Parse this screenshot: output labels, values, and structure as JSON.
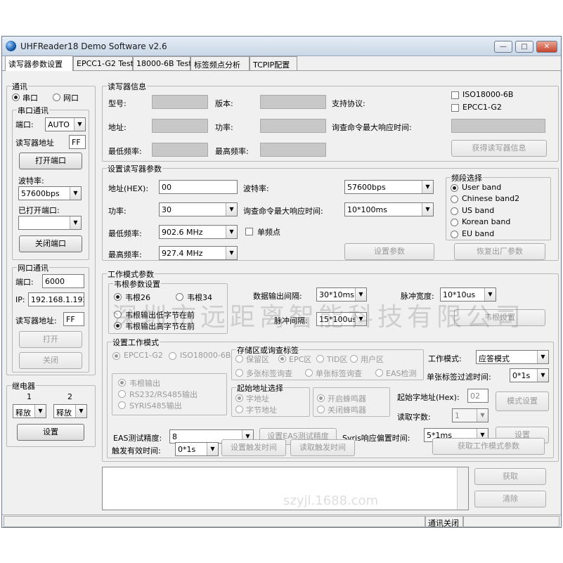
{
  "window": {
    "title": "UHFReader18 Demo Software v2.6",
    "controls": {
      "minimize": "—",
      "maximize": "□",
      "close": "✕"
    }
  },
  "tabs": [
    "读写器参数设置",
    "EPCC1-G2 Test",
    "18000-6B Test",
    "标签频点分析",
    "TCPIP配置"
  ],
  "comm": {
    "group_label": "通讯",
    "radio_serial": "串口",
    "radio_net": "网口",
    "serial_group": "串口通讯",
    "port_label": "端口:",
    "port_value": "AUTO",
    "addr_label": "读写器地址",
    "addr_value": "FF",
    "open_port_btn": "打开端口",
    "baud_label": "波特率:",
    "baud_value": "57600bps",
    "opened_label": "已打开端口:",
    "opened_value": "",
    "close_port_btn": "关闭端口",
    "net_group": "网口通讯",
    "net_port_label": "端口:",
    "net_port_value": "6000",
    "ip_label": "IP:",
    "ip_value": "192.168.1.192",
    "net_addr_label": "读写器地址:",
    "net_addr_value": "FF",
    "net_open_btn": "打开",
    "net_close_btn": "关闭"
  },
  "relay": {
    "group_label": "继电器",
    "col1": "1",
    "col2": "2",
    "sel1": "释放",
    "sel2": "释放",
    "set_btn": "设置"
  },
  "reader_info": {
    "group_label": "读写器信息",
    "model_label": "型号:",
    "version_label": "版本:",
    "protocol_label": "支持协议:",
    "proto_iso": "ISO18000-6B",
    "proto_epc": "EPCC1-G2",
    "addr_label": "地址:",
    "power_label": "功率:",
    "max_resp_label": "询查命令最大响应时间:",
    "min_freq_label": "最低频率:",
    "max_freq_label": "最高频率:",
    "get_info_btn": "获得读写器信息"
  },
  "set_params": {
    "group_label": "设置读写器参数",
    "addr_label": "地址(HEX):",
    "addr_value": "00",
    "baud_label": "波特率:",
    "baud_value": "57600bps",
    "power_label": "功率:",
    "power_value": "30",
    "resp_label": "询查命令最大响应时间:",
    "resp_value": "10*100ms",
    "min_freq_label": "最低频率:",
    "min_freq_value": "902.6 MHz",
    "single_freq_label": "单频点",
    "max_freq_label": "最高频率:",
    "max_freq_value": "927.4 MHz",
    "set_btn": "设置参数",
    "restore_btn": "恢复出厂参数",
    "band_group": "频段选择",
    "bands": [
      "User band",
      "Chinese band2",
      "US band",
      "Korean band",
      "EU band"
    ],
    "band_selected": "User band"
  },
  "work_mode_params": {
    "group_label": "工作模式参数",
    "wiegand_group": "韦根参数设置",
    "wg26": "韦根26",
    "wg34": "韦根34",
    "low_byte": "韦根输出低字节在前",
    "high_byte": "韦根输出高字节在前",
    "interval_label": "数据输出间隔:",
    "interval_value": "30*10ms",
    "pulse_width_label": "脉冲宽度:",
    "pulse_width_value": "10*10us",
    "pulse_gap_label": "脉冲间隔:",
    "pulse_gap_value": "15*100us",
    "wiegand_btn": "韦根设置"
  },
  "work_mode": {
    "group_label": "设置工作模式",
    "proto_epc": "EPCC1-G2",
    "proto_iso": "ISO18000-6B",
    "out_wiegand": "韦根输出",
    "out_rs": "RS232/RS485输出",
    "out_syris": "SYRIS485输出",
    "storage_group": "存储区或询查标签",
    "area_reserve": "保留区",
    "area_epc": "EPC区",
    "area_tid": "TID区",
    "area_user": "用户区",
    "multi_query": "多张标签询查",
    "single_query": "单张标签询查",
    "eas_detect": "EAS检测",
    "start_addr_group": "起始地址选择",
    "word_addr": "字地址",
    "byte_addr": "字节地址",
    "buzzer_on": "开启蜂鸣器",
    "buzzer_off": "关闭蜂鸣器",
    "mode_label": "工作模式:",
    "mode_value": "应答模式",
    "filter_label": "单张标签过滤时间:",
    "filter_value": "0*1s",
    "start_word_label": "起始字地址(Hex):",
    "start_word_value": "02",
    "read_words_label": "读取字数:",
    "read_words_value": "1",
    "mode_set_btn": "模式设置",
    "eas_label": "EAS测试精度:",
    "eas_value": "8",
    "eas_btn": "设置EAS测试精度",
    "syris_label": "Syris响应偏置时间:",
    "syris_value": "5*1ms",
    "syris_set_btn": "设置",
    "trigger_label": "触发有效时间:",
    "trigger_value": "0*1s",
    "trigger_set_btn": "设置触发时间",
    "trigger_read_btn": "读取触发时间",
    "get_mode_btn": "获取工作模式参数"
  },
  "log": {
    "get_btn": "获取",
    "clear_btn": "清除"
  },
  "status": {
    "text": "通讯关闭"
  },
  "watermark": {
    "text": "深圳市远距离智能科技有限公司",
    "url": "szyjl.1688.com"
  }
}
